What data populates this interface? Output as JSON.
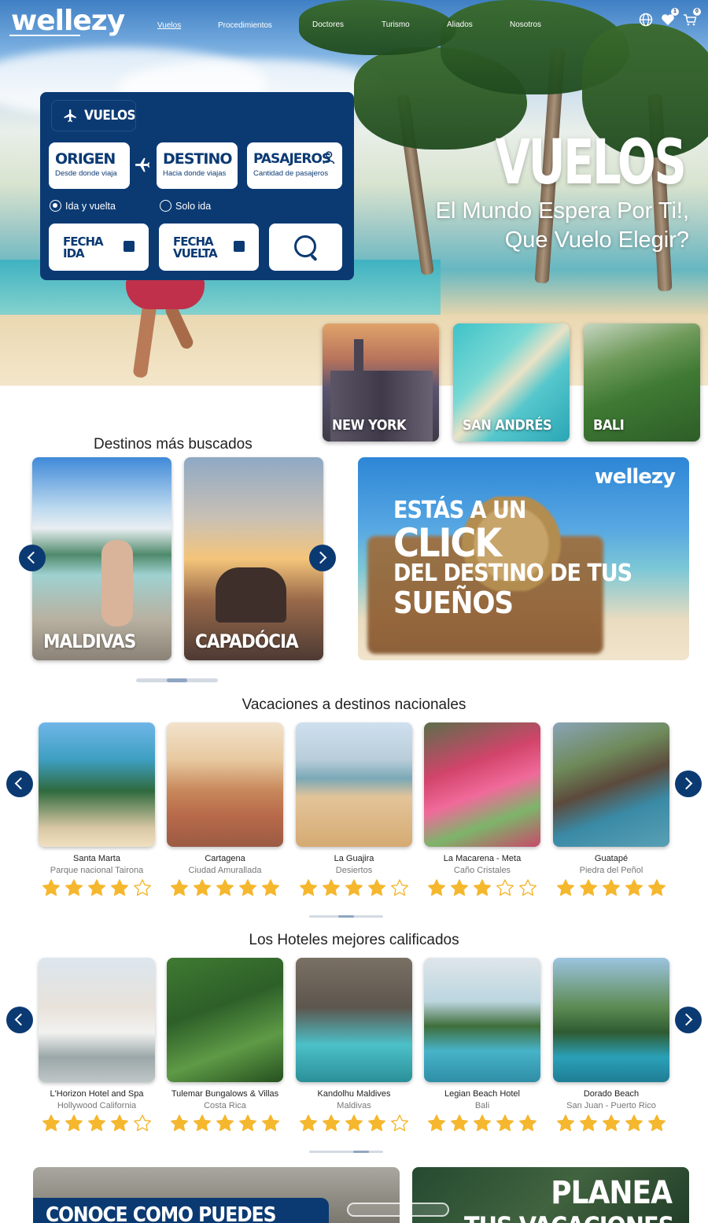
{
  "brand": {
    "logo_text": "wellezy",
    "primary_color": "#0b3a73",
    "star_color": "#f5b72e"
  },
  "nav": {
    "links": [
      "Vuelos",
      "Procedimientos",
      "Doctores",
      "Turismo",
      "Aliados",
      "Nosotros"
    ],
    "active": "Vuelos",
    "icons": [
      "globe-icon",
      "heart-icon",
      "cart-icon"
    ],
    "badges": {
      "favorites": "1",
      "cart": "0"
    }
  },
  "search": {
    "tab_label": "VUELOS",
    "origin": {
      "title": "ORIGEN",
      "hint": "Desde donde viaja"
    },
    "destination": {
      "title": "DESTINO",
      "hint": "Hacia donde viajas"
    },
    "passengers": {
      "title": "PASAJEROS",
      "hint": "Cantidad de pasajeros"
    },
    "trip_types": [
      "Ida y vuelta",
      "Solo ida"
    ],
    "selected_trip_type": "Ida y vuelta",
    "date_out": {
      "line1": "FECHA",
      "line2": "IDA"
    },
    "date_return": {
      "line1": "FECHA",
      "line2": "VUELTA"
    }
  },
  "hero": {
    "title": "VUELOS",
    "subtitle_line1": "El Mundo Espera Por Ti!,",
    "subtitle_line2": "Que Vuelo Elegir?"
  },
  "featured_cities": [
    "NEW YORK",
    "SAN ANDRÉS",
    "BALI"
  ],
  "destinos": {
    "heading": "Destinos más buscados",
    "cards": [
      "MALDIVAS",
      "CAPADÓCIA"
    ],
    "pager_position": 0.5,
    "promo": {
      "logo_text": "wellezy",
      "line1": "ESTÁS A UN",
      "line2": "CLICK",
      "line3": "DEL DESTINO DE TUS",
      "line4": "SUEÑOS"
    }
  },
  "nacionales": {
    "heading": "Vacaciones a destinos nacionales",
    "items": [
      {
        "name": "Santa Marta",
        "place": "Parque nacional Tairona",
        "rating": 4
      },
      {
        "name": "Cartagena",
        "place": "Ciudad Amurallada",
        "rating": 5
      },
      {
        "name": "La Guajira",
        "place": "Desiertos",
        "rating": 4
      },
      {
        "name": "La Macarena - Meta",
        "place": "Caño Cristales",
        "rating": 3
      },
      {
        "name": "Guatapé",
        "place": "Piedra del Peñol",
        "rating": 5
      }
    ],
    "pager_position": 0.5
  },
  "hoteles": {
    "heading": "Los Hoteles mejores calificados",
    "items": [
      {
        "name": "L'Horizon Hotel and Spa",
        "place": "Hollywood California",
        "rating": 4
      },
      {
        "name": "Tulemar Bungalows & Villas",
        "place": "Costa Rica",
        "rating": 5
      },
      {
        "name": "Kandolhu Maldives",
        "place": "Maldivas",
        "rating": 4
      },
      {
        "name": "Legian Beach Hotel",
        "place": "Bali",
        "rating": 5
      },
      {
        "name": "Dorado Beach",
        "place": "San Juan - Puerto Rico",
        "rating": 5
      }
    ],
    "pager_position": 0.75
  },
  "banners": {
    "left_text": "CONOCE COMO PUEDES",
    "right_line1": "PLANEA",
    "right_line2": "TUS VACACIONES"
  }
}
